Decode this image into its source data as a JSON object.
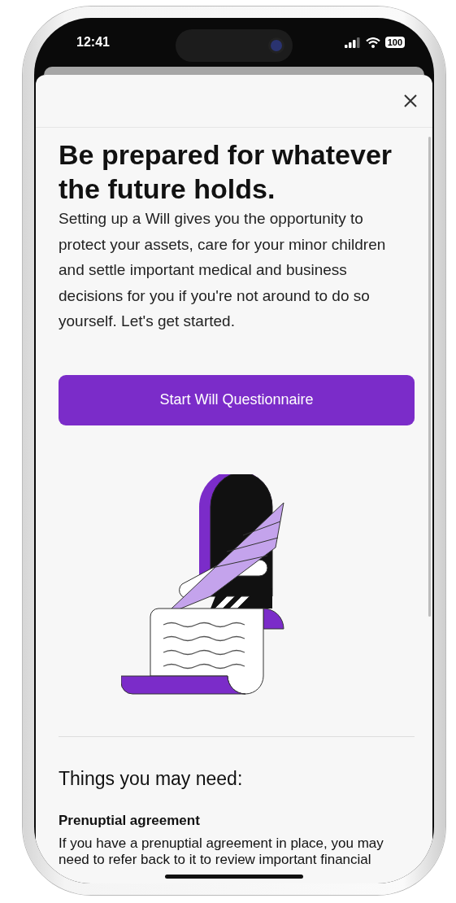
{
  "status_bar": {
    "time": "12:41",
    "battery": "100"
  },
  "sheet": {
    "title": "Be prepared for whatever the future holds.",
    "intro": "Setting up a Will gives you the opportunity to protect your assets, care for your minor children and settle important medical and business decisions for you if you're not around to do so yourself. Let's get started.",
    "primary_button": "Start Will Questionnaire",
    "section_title": "Things you may need:",
    "items": [
      {
        "title": "Prenuptial agreement",
        "description": "If you have a prenuptial agreement in place, you may need to refer back to it to review important financial"
      }
    ]
  }
}
